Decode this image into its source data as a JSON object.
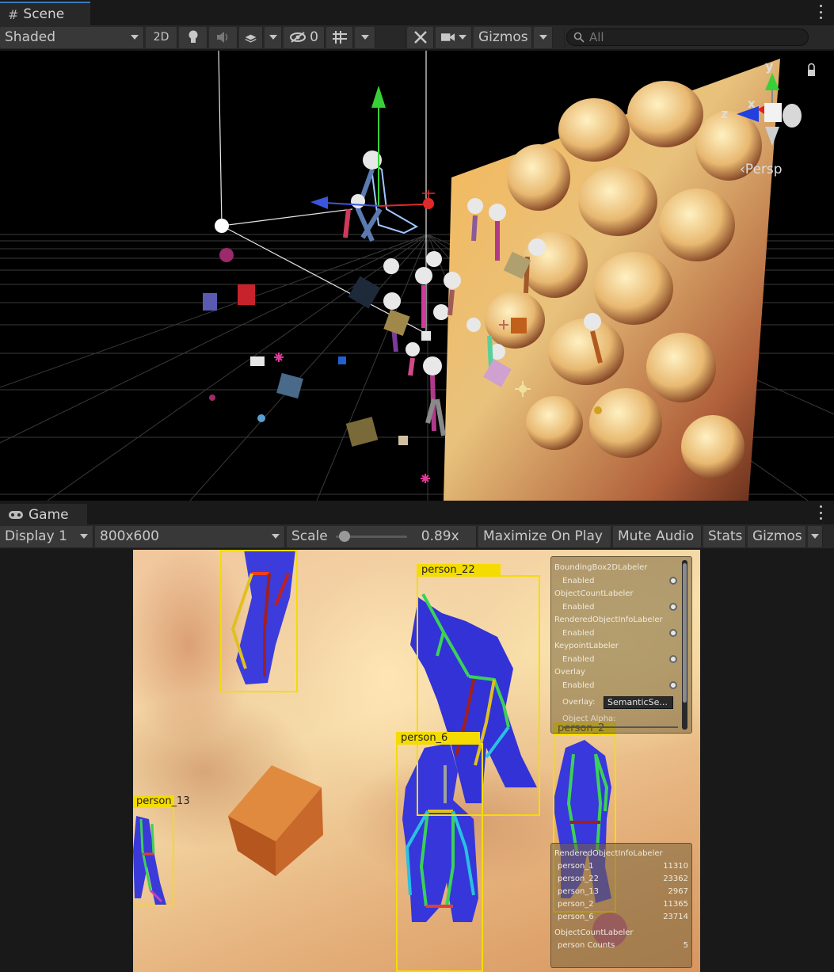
{
  "scene_panel": {
    "tab_label": "Scene",
    "shading_mode": "Shaded",
    "btn_2d": "2D",
    "hidden_count": "0",
    "gizmos_label": "Gizmos",
    "search_placeholder": "All",
    "axis_labels": {
      "y": "y",
      "x": "x",
      "z": "z"
    },
    "projection_label": "‹Persp"
  },
  "game_panel": {
    "tab_label": "Game",
    "display": "Display 1",
    "resolution": "800x600",
    "scale_label": "Scale",
    "scale_value": "0.89x",
    "scale_fraction": 0.05,
    "maximize_label": "Maximize On Play",
    "mute_label": "Mute Audio",
    "stats_label": "Stats",
    "gizmos_label": "Gizmos"
  },
  "detections": [
    {
      "label": "person_22"
    },
    {
      "label": "person_6"
    },
    {
      "label": "person_13"
    },
    {
      "label": "person_2"
    }
  ],
  "labeler_panel": {
    "items": [
      {
        "name": "BoundingBox2DLabeler",
        "state": "Enabled"
      },
      {
        "name": "ObjectCountLabeler",
        "state": "Enabled"
      },
      {
        "name": "RenderedObjectInfoLabeler",
        "state": "Enabled"
      },
      {
        "name": "KeypointLabeler",
        "state": "Enabled"
      },
      {
        "name": "Overlay",
        "state": "Enabled"
      }
    ],
    "overlay_label": "Overlay:",
    "overlay_value": "SemanticSe...",
    "alpha_label": "Object Alpha:"
  },
  "info_panel": {
    "rendered_title": "RenderedObjectInfoLabeler",
    "rows": [
      {
        "name": "person_1",
        "value": "11310"
      },
      {
        "name": "person_22",
        "value": "23362"
      },
      {
        "name": "person_13",
        "value": "2967"
      },
      {
        "name": "person_2",
        "value": "11365"
      },
      {
        "name": "person_6",
        "value": "23714"
      }
    ],
    "count_title": "ObjectCountLabeler",
    "count_row": {
      "name": "person Counts",
      "value": "5"
    }
  },
  "colors": {
    "accent_tab": "#3a79bb",
    "bbox": "#f4dc00",
    "gizmo_y": "#2fd020",
    "gizmo_x": "#e02020",
    "gizmo_z": "#2040e0"
  }
}
